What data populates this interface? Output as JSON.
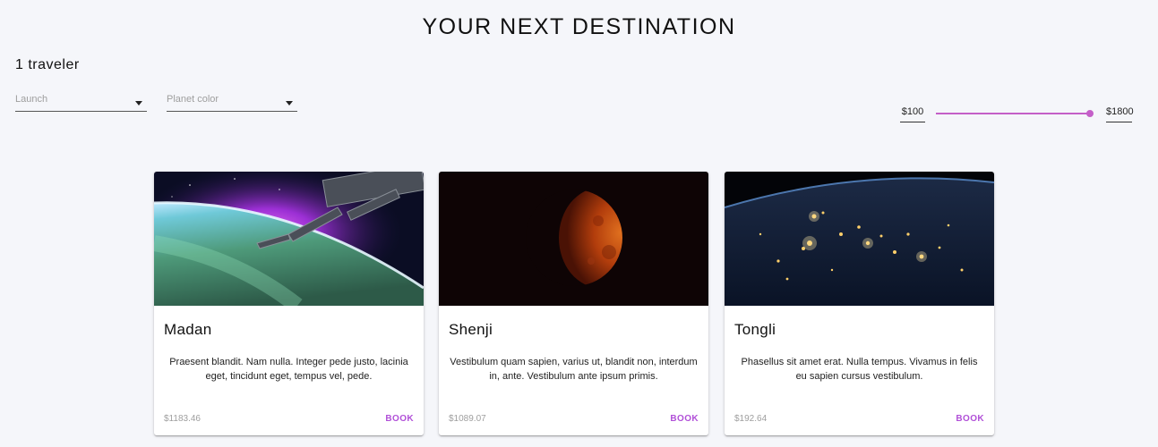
{
  "header": {
    "title": "YOUR NEXT DESTINATION",
    "travelers": "1 traveler"
  },
  "filters": {
    "launch_placeholder": "Launch",
    "color_placeholder": "Planet color",
    "price_min": "$100",
    "price_max": "$1800",
    "price_range": {
      "min": 100,
      "max": 1800
    },
    "accent_color": "#c45fc8"
  },
  "cards": [
    {
      "name": "Madan",
      "description": "Praesent blandit. Nam nulla. Integer pede justo, lacinia eget, tincidunt eget, tempus vel, pede.",
      "price": "$1183.46",
      "action": "BOOK",
      "image": "space-station-aurora"
    },
    {
      "name": "Shenji",
      "description": "Vestibulum quam sapien, varius ut, blandit non, interdum in, ante. Vestibulum ante ipsum primis.",
      "price": "$1089.07",
      "action": "BOOK",
      "image": "red-moon"
    },
    {
      "name": "Tongli",
      "description": "Phasellus sit amet erat. Nulla tempus. Vivamus in felis eu sapien cursus vestibulum.",
      "price": "$192.64",
      "action": "BOOK",
      "image": "earth-night-lights"
    }
  ]
}
